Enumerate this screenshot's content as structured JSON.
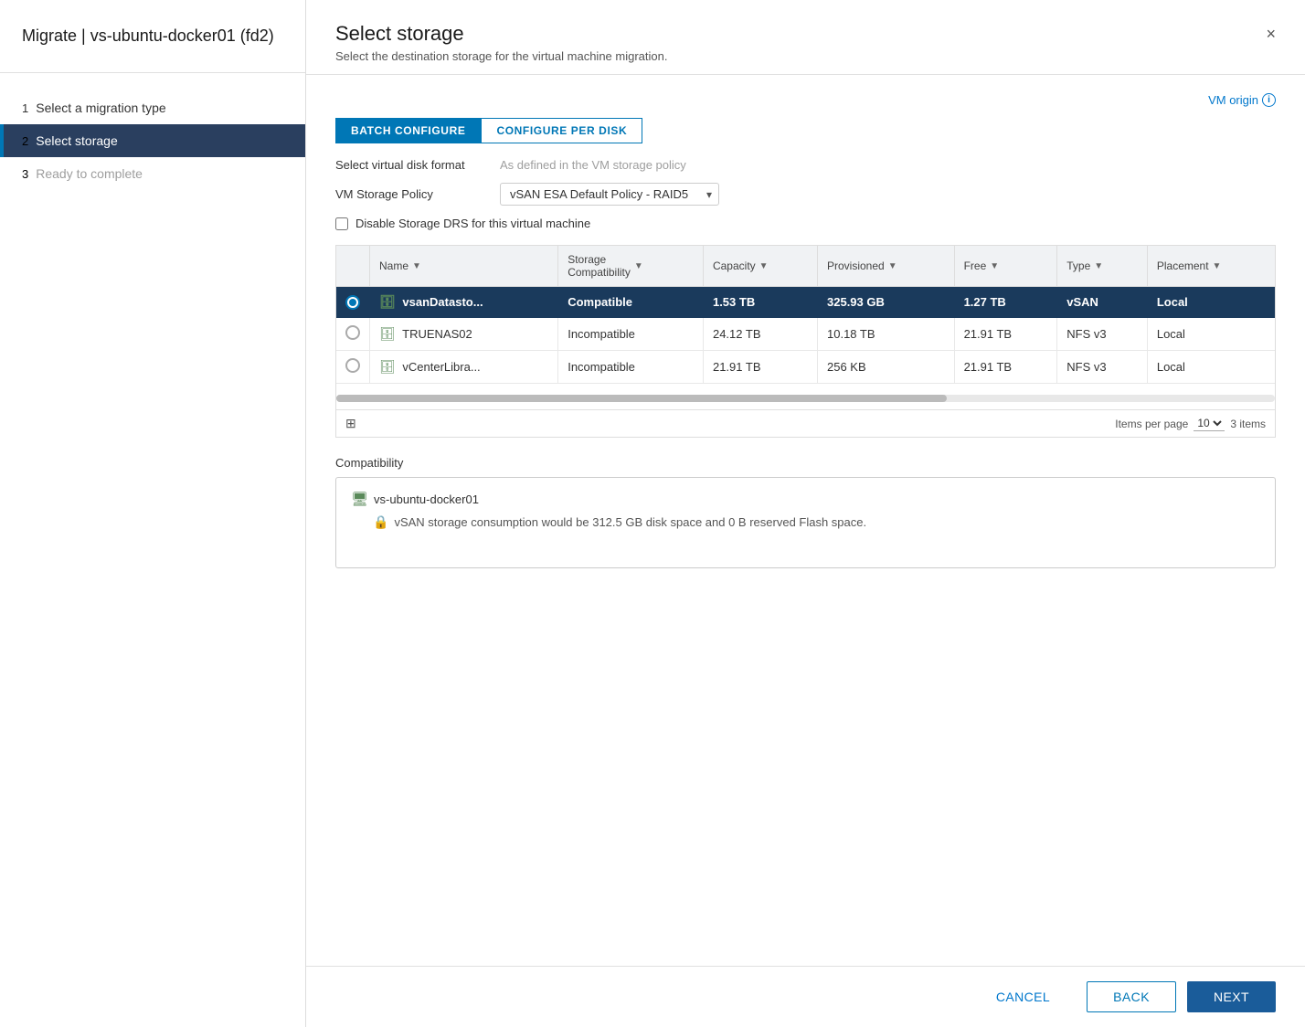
{
  "sidebar": {
    "title": "Migrate | vs-ubuntu-docker01 (fd2)",
    "steps": [
      {
        "number": "1",
        "label": "Select a migration type",
        "state": "done"
      },
      {
        "number": "2",
        "label": "Select storage",
        "state": "active"
      },
      {
        "number": "3",
        "label": "Ready to complete",
        "state": "inactive"
      }
    ]
  },
  "dialog": {
    "title": "Select storage",
    "subtitle": "Select the destination storage for the virtual machine migration.",
    "close_label": "×",
    "vm_origin_label": "VM origin",
    "toggle_batch": "BATCH CONFIGURE",
    "toggle_per_disk": "CONFIGURE PER DISK",
    "form": {
      "disk_format_label": "Select virtual disk format",
      "disk_format_value": "As defined in the VM storage policy",
      "storage_policy_label": "VM Storage Policy",
      "storage_policy_value": "vSAN ESA Default Policy - RAID5",
      "disable_drs_label": "Disable Storage DRS for this virtual machine"
    },
    "table": {
      "columns": [
        "",
        "Name",
        "Storage Compatibility",
        "Capacity",
        "Provisioned",
        "Free",
        "Type",
        "Placement"
      ],
      "rows": [
        {
          "selected": true,
          "name": "vsanDatasto...",
          "compatibility": "Compatible",
          "capacity": "1.53 TB",
          "provisioned": "325.93 GB",
          "free": "1.27 TB",
          "type": "vSAN",
          "placement": "Local"
        },
        {
          "selected": false,
          "name": "TRUENAS02",
          "compatibility": "Incompatible",
          "capacity": "24.12 TB",
          "provisioned": "10.18 TB",
          "free": "21.91 TB",
          "type": "NFS v3",
          "placement": "Local"
        },
        {
          "selected": false,
          "name": "vCenterLibra...",
          "compatibility": "Incompatible",
          "capacity": "21.91 TB",
          "provisioned": "256 KB",
          "free": "21.91 TB",
          "type": "NFS v3",
          "placement": "Local"
        }
      ],
      "footer": {
        "items_per_page_label": "Items per page",
        "items_per_page_value": "10",
        "total_items": "3 items"
      }
    },
    "compatibility": {
      "section_label": "Compatibility",
      "vm_name": "vs-ubuntu-docker01",
      "info_text": "vSAN storage consumption would be 312.5 GB disk space and 0 B reserved Flash space."
    },
    "footer": {
      "cancel_label": "CANCEL",
      "back_label": "BACK",
      "next_label": "NEXT"
    }
  }
}
